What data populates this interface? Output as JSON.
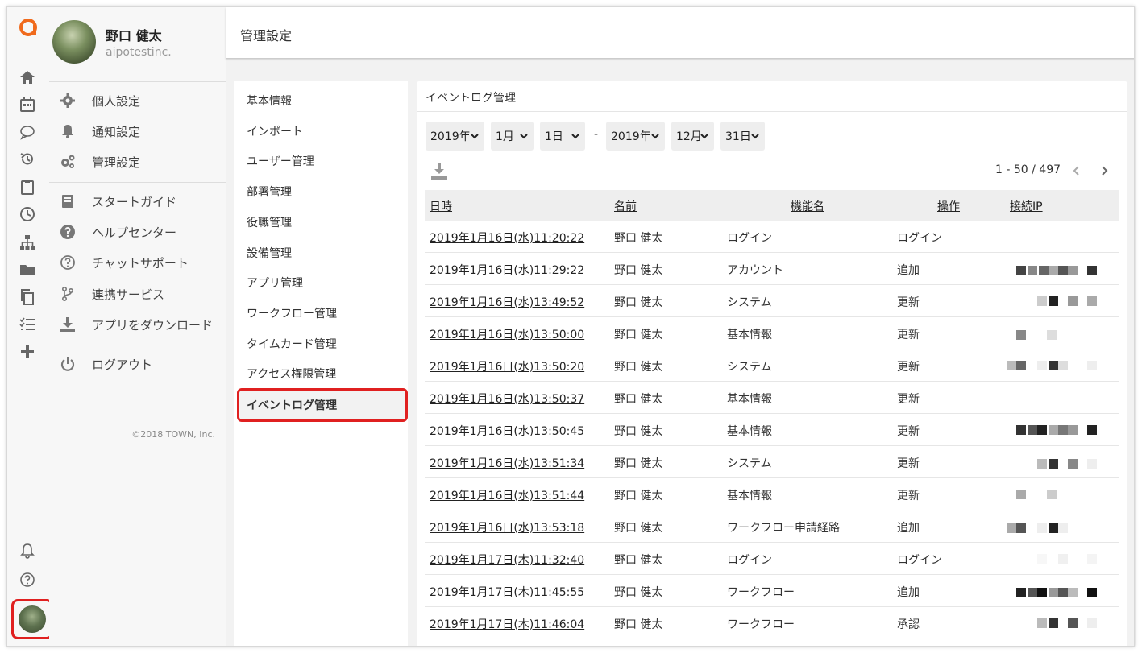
{
  "app": {
    "user_name": "野口 健太",
    "company": "aipotestinc.",
    "copyright": "©2018 TOWN, Inc."
  },
  "rail_icons": [
    "home-icon",
    "calendar-icon",
    "chat-icon",
    "history-icon",
    "clipboard-icon",
    "clock-icon",
    "org-chart-icon",
    "folder-icon",
    "copy-icon",
    "checklist-icon",
    "plus-icon"
  ],
  "user_menu": [
    {
      "label": "個人設定",
      "icon": "gear-icon"
    },
    {
      "label": "通知設定",
      "icon": "bell-icon"
    },
    {
      "label": "管理設定",
      "icon": "gears-icon"
    },
    {
      "label": "スタートガイド",
      "icon": "book-icon"
    },
    {
      "label": "ヘルプセンター",
      "icon": "question-circle-icon"
    },
    {
      "label": "チャットサポート",
      "icon": "question-outline-icon"
    },
    {
      "label": "連携サービス",
      "icon": "branch-icon"
    },
    {
      "label": "アプリをダウンロード",
      "icon": "download-icon"
    },
    {
      "label": "ログアウト",
      "icon": "power-icon"
    }
  ],
  "header": {
    "title": "管理設定"
  },
  "settings_nav": [
    "基本情報",
    "インポート",
    "ユーザー管理",
    "部署管理",
    "役職管理",
    "設備管理",
    "アプリ管理",
    "ワークフロー管理",
    "タイムカード管理",
    "アクセス権限管理",
    "イベントログ管理"
  ],
  "settings_nav_active": "イベントログ管理",
  "panel": {
    "title": "イベントログ管理",
    "filters": {
      "from_year": "2019年",
      "from_month": "1月",
      "from_day": "1日",
      "separator": "-",
      "to_year": "2019年",
      "to_month": "12月",
      "to_day": "31日"
    },
    "pagination": "1 - 50 / 497"
  },
  "table": {
    "headers": {
      "date": "日時",
      "name": "名前",
      "feature": "機能名",
      "operation": "操作",
      "ip": "接続IP"
    },
    "rows": [
      {
        "date": "2019年1月16日(水)11:20:22",
        "name": "野口 健太",
        "feature": "ログイン",
        "operation": "ログイン"
      },
      {
        "date": "2019年1月16日(水)11:29:22",
        "name": "野口 健太",
        "feature": "アカウント",
        "operation": "追加"
      },
      {
        "date": "2019年1月16日(水)13:49:52",
        "name": "野口 健太",
        "feature": "システム",
        "operation": "更新"
      },
      {
        "date": "2019年1月16日(水)13:50:00",
        "name": "野口 健太",
        "feature": "基本情報",
        "operation": "更新"
      },
      {
        "date": "2019年1月16日(水)13:50:20",
        "name": "野口 健太",
        "feature": "システム",
        "operation": "更新"
      },
      {
        "date": "2019年1月16日(水)13:50:37",
        "name": "野口 健太",
        "feature": "基本情報",
        "operation": "更新"
      },
      {
        "date": "2019年1月16日(水)13:50:45",
        "name": "野口 健太",
        "feature": "基本情報",
        "operation": "更新"
      },
      {
        "date": "2019年1月16日(水)13:51:34",
        "name": "野口 健太",
        "feature": "システム",
        "operation": "更新"
      },
      {
        "date": "2019年1月16日(水)13:51:44",
        "name": "野口 健太",
        "feature": "基本情報",
        "operation": "更新"
      },
      {
        "date": "2019年1月16日(水)13:53:18",
        "name": "野口 健太",
        "feature": "ワークフロー申請経路",
        "operation": "追加"
      },
      {
        "date": "2019年1月17日(木)11:32:40",
        "name": "野口 健太",
        "feature": "ログイン",
        "operation": "ログイン"
      },
      {
        "date": "2019年1月17日(木)11:45:55",
        "name": "野口 健太",
        "feature": "ワークフロー",
        "operation": "追加"
      },
      {
        "date": "2019年1月17日(木)11:46:04",
        "name": "野口 健太",
        "feature": "ワークフロー",
        "operation": "承認"
      }
    ]
  },
  "colors": {
    "accent": "#f06a1c",
    "highlight": "#e02020",
    "header_bg": "#eeeeee"
  }
}
